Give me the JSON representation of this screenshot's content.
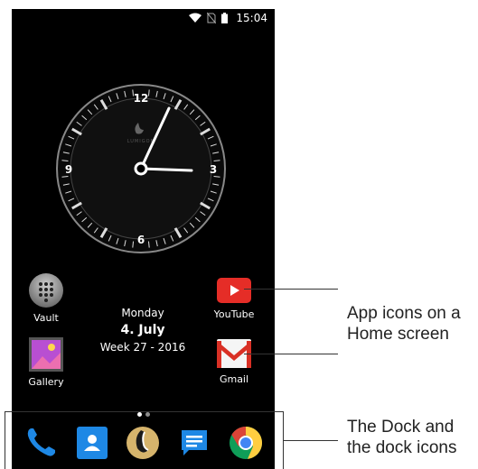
{
  "status_bar": {
    "time": "15:04",
    "icons": [
      "wifi-icon",
      "no-sim-icon",
      "battery-icon"
    ]
  },
  "clock": {
    "brand": "LUMIGON",
    "numerals": [
      "12",
      "3",
      "6",
      "9"
    ]
  },
  "home_apps": [
    {
      "label": "Vault",
      "icon": "dial-grid-icon"
    },
    {
      "label": "YouTube",
      "icon": "youtube-icon"
    },
    {
      "label": "Gallery",
      "icon": "gallery-icon"
    },
    {
      "label": "Gmail",
      "icon": "gmail-icon"
    }
  ],
  "date_widget": {
    "day_of_week": "Monday",
    "date": "4. July",
    "week": "Week 27 - 2016"
  },
  "page_indicator": {
    "pages": 2,
    "current": 1
  },
  "dock": [
    {
      "icon": "phone-icon"
    },
    {
      "icon": "contacts-icon"
    },
    {
      "icon": "lumigon-icon"
    },
    {
      "icon": "messages-icon"
    },
    {
      "icon": "chrome-icon"
    }
  ],
  "annotations": {
    "app_icons": "App icons on a Home screen",
    "dock": "The Dock and the dock icons"
  },
  "colors": {
    "youtube_red": "#e52d27",
    "chrome_green": "#0f9d58",
    "phone_blue": "#1e88e5"
  }
}
